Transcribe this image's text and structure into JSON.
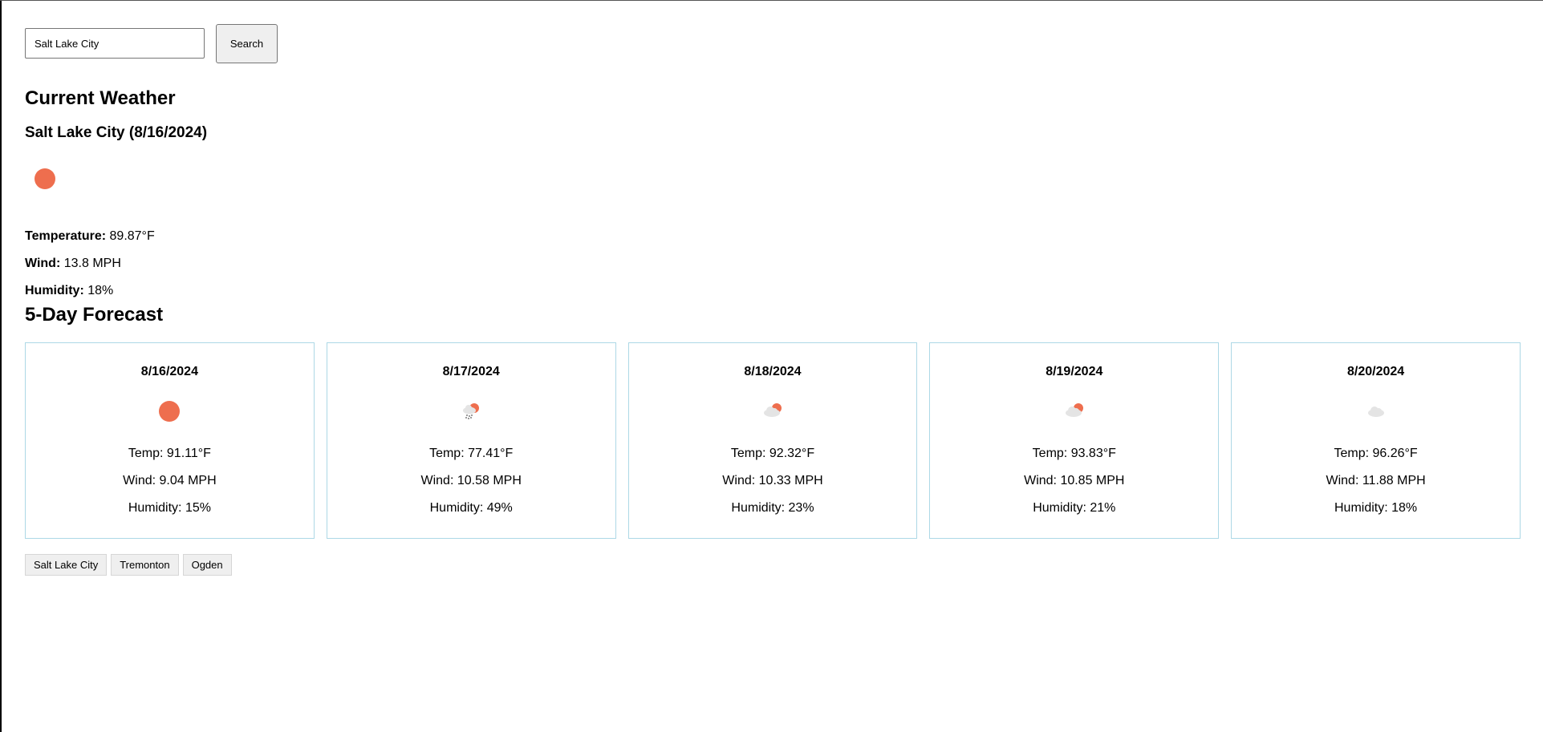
{
  "search": {
    "value": "Salt Lake City",
    "button_label": "Search"
  },
  "current": {
    "section_title": "Current Weather",
    "city_heading": "Salt Lake City (8/16/2024)",
    "icon": "sun-icon",
    "temperature_label": "Temperature:",
    "temperature_value": "89.87°F",
    "wind_label": "Wind:",
    "wind_value": "13.8 MPH",
    "humidity_label": "Humidity:",
    "humidity_value": "18%"
  },
  "forecast": {
    "section_title": "5-Day Forecast",
    "days": [
      {
        "date": "8/16/2024",
        "icon": "sun-icon",
        "temp": "Temp: 91.11°F",
        "wind": "Wind: 9.04 MPH",
        "humidity": "Humidity: 15%"
      },
      {
        "date": "8/17/2024",
        "icon": "rain-sun-icon",
        "temp": "Temp: 77.41°F",
        "wind": "Wind: 10.58 MPH",
        "humidity": "Humidity: 49%"
      },
      {
        "date": "8/18/2024",
        "icon": "partly-cloudy-icon",
        "temp": "Temp: 92.32°F",
        "wind": "Wind: 10.33 MPH",
        "humidity": "Humidity: 23%"
      },
      {
        "date": "8/19/2024",
        "icon": "partly-cloudy-icon",
        "temp": "Temp: 93.83°F",
        "wind": "Wind: 10.85 MPH",
        "humidity": "Humidity: 21%"
      },
      {
        "date": "8/20/2024",
        "icon": "cloud-icon",
        "temp": "Temp: 96.26°F",
        "wind": "Wind: 11.88 MPH",
        "humidity": "Humidity: 18%"
      }
    ]
  },
  "history": {
    "cities": [
      "Salt Lake City",
      "Tremonton",
      "Ogden"
    ]
  },
  "colors": {
    "sun": "#ee6e4e",
    "cloud": "#e4e4e4",
    "card_border": "#add8e6",
    "button_bg": "#efefef"
  }
}
